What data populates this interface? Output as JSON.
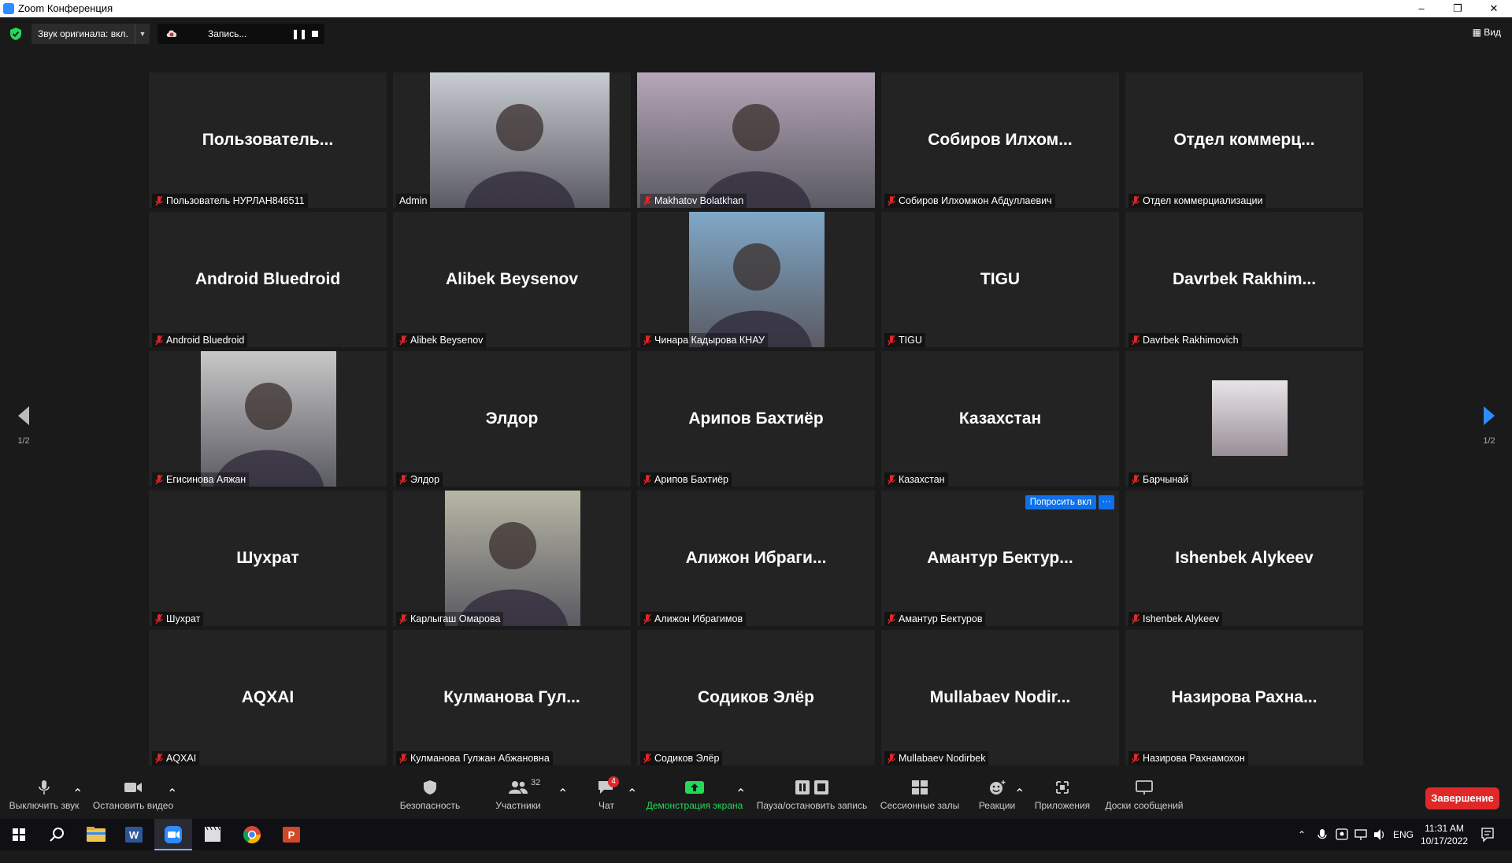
{
  "window": {
    "title": "Zoom Конференция",
    "minimize": "–",
    "restore": "❐",
    "close": "✕"
  },
  "topbar": {
    "original_sound": "Звук оригинала: вкл.",
    "recording": "Запись...",
    "pause_glyph": "❚❚",
    "view": "Вид"
  },
  "pager": {
    "page": "1/2"
  },
  "tiles": [
    {
      "big": "Пользователь...",
      "label": "Пользователь НУРЛАН846511",
      "muted": true
    },
    {
      "big": "",
      "label": "Admin",
      "muted": false,
      "video": true
    },
    {
      "big": "",
      "label": "Makhatov Bolatkhan",
      "muted": true,
      "video": true
    },
    {
      "big": "Собиров Илхом...",
      "label": "Собиров Илхомжон Абдуллаевич",
      "muted": true
    },
    {
      "big": "Отдел коммерц...",
      "label": "Отдел коммерциализации",
      "muted": true
    },
    {
      "big": "Android Bluedroid",
      "label": "Android Bluedroid",
      "muted": true
    },
    {
      "big": "Alibek Beysenov",
      "label": "Alibek Beysenov",
      "muted": true
    },
    {
      "big": "",
      "label": "Чинара Кадырова КНАУ",
      "muted": true,
      "video": true
    },
    {
      "big": "TIGU",
      "label": "TIGU",
      "muted": true
    },
    {
      "big": "Davrbek Rakhim...",
      "label": "Davrbek Rakhimovich",
      "muted": true
    },
    {
      "big": "",
      "label": "Егисинова Аяжан",
      "muted": true,
      "video": true
    },
    {
      "big": "Элдор",
      "label": "Элдор",
      "muted": true
    },
    {
      "big": "Арипов Бахтиёр",
      "label": "Арипов Бахтиёр",
      "muted": true
    },
    {
      "big": "Казахстан",
      "label": "Казахстан",
      "muted": true
    },
    {
      "big": "",
      "label": "Барчынай",
      "muted": true,
      "avatar": true
    },
    {
      "big": "Шухрат",
      "label": "Шухрат",
      "muted": true
    },
    {
      "big": "",
      "label": "Карлыгаш Омарова",
      "muted": true,
      "video": true
    },
    {
      "big": "Алижон Ибраги...",
      "label": "Алижон Ибрагимов",
      "muted": true
    },
    {
      "big": "Амантур Бектур...",
      "label": "Амантур Бектуров",
      "muted": true
    },
    {
      "big": "Ishenbek Alykeev",
      "label": "Ishenbek Alykeev",
      "muted": true
    },
    {
      "big": "AQXAI",
      "label": "AQXAI",
      "muted": true
    },
    {
      "big": "Кулманова Гул...",
      "label": "Кулманова Гулжан Абжановна",
      "muted": true
    },
    {
      "big": "Содиков Элёр",
      "label": "Содиков Элёр",
      "muted": true
    },
    {
      "big": "Mullabaev Nodir...",
      "label": "Mullabaev Nodirbek",
      "muted": true
    },
    {
      "big": "Назирова Рахна...",
      "label": "Назирова Рахнамохон",
      "muted": true
    }
  ],
  "hover_tile": {
    "ask_unmute": "Попросить вкл",
    "more": "···"
  },
  "toolbar": {
    "mute": "Выключить звук",
    "video": "Остановить видео",
    "security": "Безопасность",
    "participants": "Участники",
    "participants_count": "32",
    "chat": "Чат",
    "chat_badge": "4",
    "share": "Демонстрация экрана",
    "pause_record": "Пауза/остановить запись",
    "breakout": "Сессионные залы",
    "reactions": "Реакции",
    "apps": "Приложения",
    "whiteboards": "Доски сообщений",
    "end": "Завершение"
  },
  "taskbar": {
    "lang": "ENG",
    "time": "11:31 AM",
    "date": "10/17/2022"
  },
  "colors": {
    "accent": "#0e71eb",
    "end": "#e02828",
    "share_green": "#23d959",
    "mute_red": "#e02828"
  }
}
